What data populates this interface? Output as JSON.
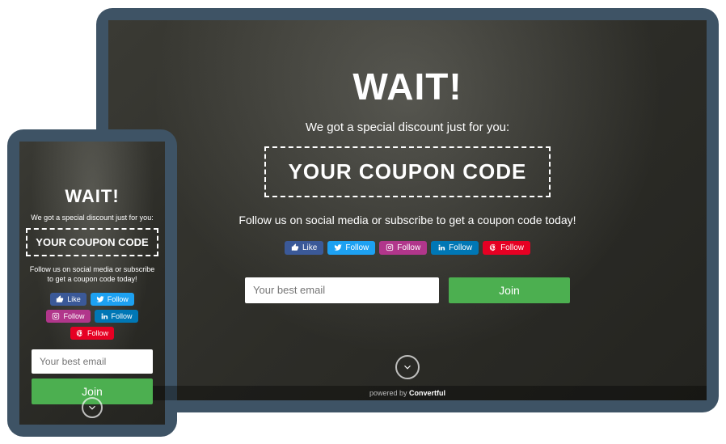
{
  "popup": {
    "title": "WAIT!",
    "subtitle": "We got a special discount just for you:",
    "coupon": "YOUR COUPON CODE",
    "cta_desktop": "Follow us on social media or subscribe to get a coupon code today!",
    "cta_mobile": "Follow us on social media or subscribe to get a coupon code today!",
    "email_placeholder": "Your best email",
    "join_label": "Join"
  },
  "social": {
    "facebook": "Like",
    "twitter": "Follow",
    "instagram": "Follow",
    "linkedin": "Follow",
    "pinterest": "Follow"
  },
  "footer": {
    "prefix": "powered by ",
    "brand": "Convertful"
  },
  "colors": {
    "frame": "#3e5365",
    "join": "#4caf50",
    "facebook": "#3b5998",
    "twitter": "#1da1f2",
    "instagram": "#b1368b",
    "linkedin": "#0077b5",
    "pinterest": "#e60023"
  }
}
